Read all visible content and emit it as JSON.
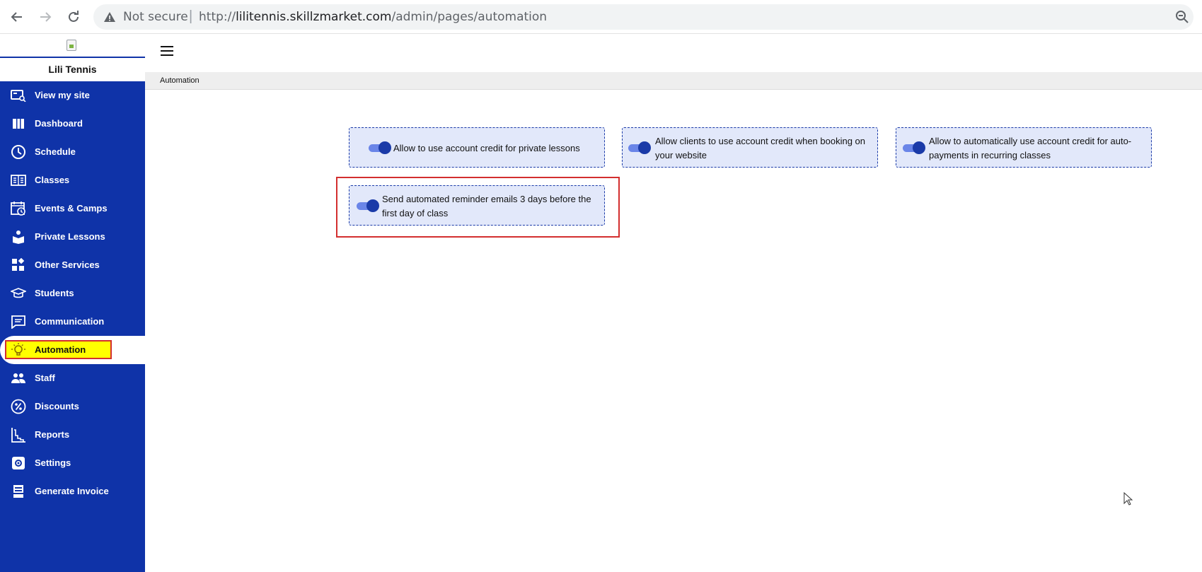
{
  "browser": {
    "security_label": "Not secure",
    "separator": "|",
    "url_scheme": "http://",
    "url_host": "lilitennis.skillzmarket.com",
    "url_path": "/admin/pages/automation"
  },
  "sidebar": {
    "brand_name": "Lili Tennis",
    "accent_color": "#0f33a8",
    "items": [
      {
        "label": "View my site",
        "icon": "view-site-icon"
      },
      {
        "label": "Dashboard",
        "icon": "dashboard-icon"
      },
      {
        "label": "Schedule",
        "icon": "clock-icon"
      },
      {
        "label": "Classes",
        "icon": "classes-icon"
      },
      {
        "label": "Events & Camps",
        "icon": "calendar-clock-icon"
      },
      {
        "label": "Private Lessons",
        "icon": "private-lesson-icon"
      },
      {
        "label": "Other Services",
        "icon": "services-icon"
      },
      {
        "label": "Students",
        "icon": "graduation-cap-icon"
      },
      {
        "label": "Communication",
        "icon": "message-icon"
      },
      {
        "label": "Automation",
        "icon": "lightbulb-icon",
        "active": true
      },
      {
        "label": "Staff",
        "icon": "people-icon"
      },
      {
        "label": "Discounts",
        "icon": "percent-icon"
      },
      {
        "label": "Reports",
        "icon": "reports-icon"
      },
      {
        "label": "Settings",
        "icon": "settings-icon"
      },
      {
        "label": "Generate Invoice",
        "icon": "invoice-icon"
      }
    ]
  },
  "main": {
    "breadcrumb": "Automation",
    "settings": [
      {
        "label": "Allow to use account credit for private lessons",
        "enabled": true
      },
      {
        "label": "Allow clients to use account credit when booking on your website",
        "enabled": true
      },
      {
        "label": "Allow to automatically use account credit for auto-payments in recurring classes",
        "enabled": true
      },
      {
        "label": "Send automated reminder emails 3 days before the first day of class",
        "enabled": true
      }
    ]
  }
}
